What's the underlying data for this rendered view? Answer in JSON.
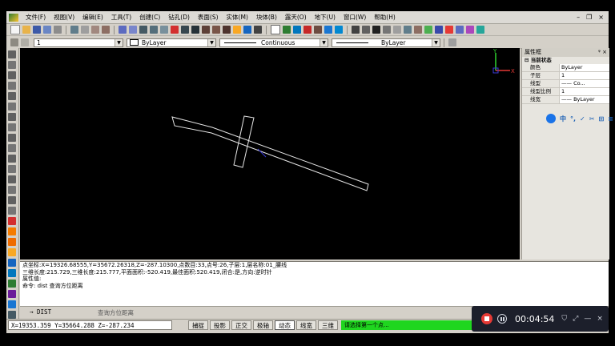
{
  "menu": {
    "items": [
      "文件(F)",
      "视图(V)",
      "编辑(E)",
      "工具(T)",
      "创建(C)",
      "钻孔(D)",
      "表面(S)",
      "实体(M)",
      "块体(B)",
      "露天(O)",
      "地下(U)",
      "窗口(W)",
      "帮助(H)"
    ]
  },
  "toolbar2": {
    "layer_value": "1",
    "color_value": "ByLayer",
    "linetype_value": "Continuous",
    "lineweight_value": "ByLayer"
  },
  "props": {
    "title": "属性框",
    "section": "当前状态",
    "rows": [
      {
        "key": "颜色",
        "value": "ByLayer"
      },
      {
        "key": "子层",
        "value": "1"
      },
      {
        "key": "线型",
        "value": "—— Co..."
      },
      {
        "key": "线型比例",
        "value": "1"
      },
      {
        "key": "线宽",
        "value": "—— ByLayer"
      }
    ],
    "ime": [
      "中",
      "°,",
      "✓",
      "✂",
      "⊞",
      "≡"
    ]
  },
  "canvas": {
    "axis_y": "Y",
    "axis_x": "X"
  },
  "cmd": {
    "lines": [
      "点坐标:X=19326.68555,Y=35672.26318,Z=-287.10300,点数目:33,点号:26,子层:1,层名称:01_腰线",
      "三维长度:215.729,三维长度:215.777,平面面积:-520.419,最佳面积:520.419,闭合:是,方向:逆时针",
      "属性值:",
      "命令: dist  查询方位距离"
    ],
    "input_cmd": "DIST",
    "input_hint": "查询方位距离"
  },
  "status": {
    "coords": "X=19353.359 Y=35664.288 Z=-287.234",
    "buttons": [
      {
        "label": "捕捉",
        "on": false
      },
      {
        "label": "投影",
        "on": false
      },
      {
        "label": "正交",
        "on": false
      },
      {
        "label": "极轴",
        "on": false
      },
      {
        "label": "动态",
        "on": true
      },
      {
        "label": "线宽",
        "on": false
      },
      {
        "label": "三维",
        "on": false
      }
    ],
    "prompt": "请选择第一个点..."
  },
  "recorder": {
    "time": "00:04:54"
  },
  "colors": {
    "prompt_bg": "#1fd61f",
    "recorder_bg": "#1c1f2b",
    "record_red": "#e53935"
  }
}
